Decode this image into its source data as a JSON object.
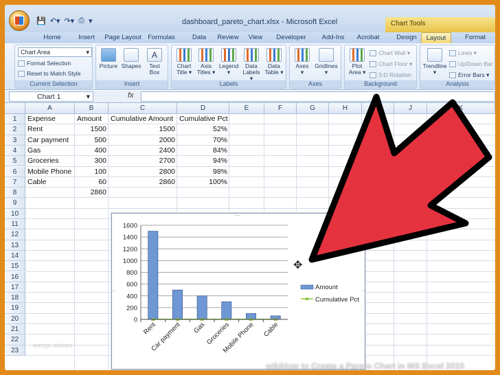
{
  "window": {
    "title": "dashboard_pareto_chart.xlsx - Microsoft Excel",
    "context_tab": "Chart Tools"
  },
  "tabs": [
    "Home",
    "Insert",
    "Page Layout",
    "Formulas",
    "Data",
    "Review",
    "View",
    "Developer",
    "Add-Ins",
    "Acrobat",
    "Design",
    "Layout",
    "Format"
  ],
  "active_tab": "Layout",
  "ribbon": {
    "current_selection": {
      "dropdown": "Chart Area",
      "format_selection": "Format Selection",
      "reset": "Reset to Match Style",
      "label": "Current Selection"
    },
    "insert": {
      "buttons": [
        "Picture",
        "Shapes",
        "Text Box"
      ],
      "label": "Insert"
    },
    "labels": {
      "buttons": [
        {
          "l1": "Chart",
          "l2": "Title ▾"
        },
        {
          "l1": "Axis",
          "l2": "Titles ▾"
        },
        {
          "l1": "Legend",
          "l2": "▾"
        },
        {
          "l1": "Data",
          "l2": "Labels ▾"
        },
        {
          "l1": "Data",
          "l2": "Table ▾"
        }
      ],
      "label": "Labels"
    },
    "axes": {
      "buttons": [
        {
          "l1": "Axes",
          "l2": "▾"
        },
        {
          "l1": "Gridlines",
          "l2": "▾"
        }
      ],
      "label": "Axes"
    },
    "background": {
      "plot_area": {
        "l1": "Plot",
        "l2": "Area ▾"
      },
      "chart_wall": "Chart Wall ▾",
      "chart_floor": "Chart Floor ▾",
      "rotation": "3-D Rotation",
      "label": "Background"
    },
    "analysis": {
      "trendline": {
        "l1": "Trendline",
        "l2": "▾"
      },
      "lines": "Lines ▾",
      "updown": "Up/Down Bar",
      "error": "Error Bars ▾",
      "label": "Analysis"
    }
  },
  "formula_bar": {
    "name_box": "Chart 1",
    "fx": "fx",
    "value": ""
  },
  "columns": [
    "A",
    "B",
    "C",
    "D",
    "E",
    "F",
    "G",
    "H",
    "I",
    "J",
    "K"
  ],
  "rows": [
    "1",
    "2",
    "3",
    "4",
    "5",
    "6",
    "7",
    "8",
    "9",
    "10",
    "11",
    "12",
    "13",
    "14",
    "15",
    "16",
    "17",
    "18",
    "19",
    "20",
    "21",
    "22",
    "23"
  ],
  "sheet": {
    "headers": [
      "Expense",
      "Amount",
      "Cumulative Amount",
      "Cumulative Pct"
    ],
    "data": [
      [
        "Rent",
        "1500",
        "1500",
        "52%"
      ],
      [
        "Car payment",
        "500",
        "2000",
        "70%"
      ],
      [
        "Gas",
        "400",
        "2400",
        "84%"
      ],
      [
        "Groceries",
        "300",
        "2700",
        "94%"
      ],
      [
        "Mobile Phone",
        "100",
        "2800",
        "98%"
      ],
      [
        "Cable",
        "60",
        "2860",
        "100%"
      ]
    ],
    "total": "2860"
  },
  "chart_data": {
    "type": "bar",
    "categories": [
      "Rent",
      "Car payment",
      "Gas",
      "Groceries",
      "Mobile Phone",
      "Cable"
    ],
    "series": [
      {
        "name": "Amount",
        "type": "bar",
        "values": [
          1500,
          500,
          400,
          300,
          100,
          60
        ],
        "color": "#6e97d4"
      },
      {
        "name": "Cumulative Pct",
        "type": "line",
        "values": [
          0.52,
          0.7,
          0.84,
          0.94,
          0.98,
          1.0
        ],
        "color": "#8dc63f"
      }
    ],
    "yticks": [
      "0",
      "200",
      "400",
      "600",
      "800",
      "1000",
      "1200",
      "1400",
      "1600"
    ],
    "ylim": [
      0,
      1600
    ],
    "grid": true,
    "legend_position": "right"
  },
  "overlay": {
    "arrow_color": "#e4323f",
    "caption": "wikiHow to Create a Pareto Chart in MS Excel 2010",
    "watermark": "wedge.latelate"
  }
}
